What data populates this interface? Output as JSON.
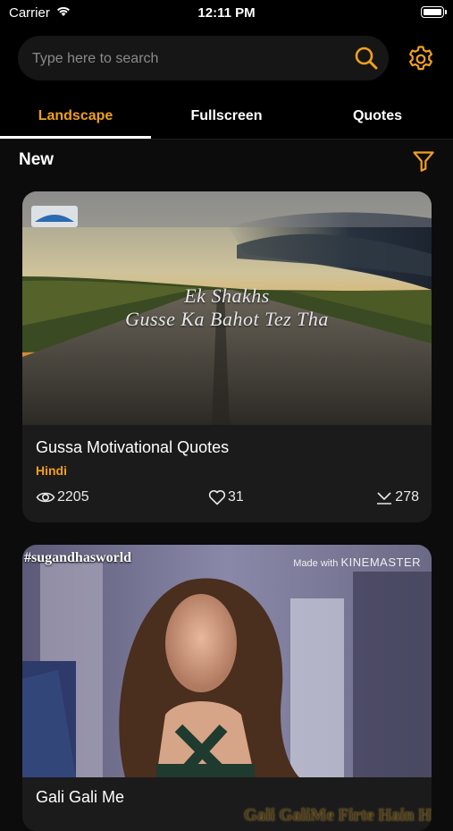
{
  "status_bar": {
    "carrier": "Carrier",
    "time": "12:11 PM"
  },
  "search": {
    "placeholder": "Type here to search"
  },
  "tabs": [
    {
      "label": "Landscape",
      "active": true
    },
    {
      "label": "Fullscreen",
      "active": false
    },
    {
      "label": "Quotes",
      "active": false
    }
  ],
  "section": {
    "title": "New"
  },
  "colors": {
    "accent": "#f0a020",
    "background": "#0c0c0c",
    "card": "#1b1b1b"
  },
  "cards": [
    {
      "thumbnail_text_line1": "Ek Shakhs",
      "thumbnail_text_line2": "Gusse Ka Bahot Tez Tha",
      "title": "Gussa Motivational Quotes",
      "language": "Hindi",
      "views": "2205",
      "likes": "31",
      "downloads": "278"
    },
    {
      "thumbnail_tag": "#sugandhasworld",
      "thumbnail_watermark_prefix": "Made with",
      "thumbnail_watermark_brand": "KINEMASTER",
      "thumbnail_lyric": "Gali GaliMe Firte Hain H",
      "title": "Gali Gali Me"
    }
  ],
  "icons": {
    "search": "search-icon",
    "settings": "gear-icon",
    "filter": "filter-icon",
    "views": "eye-icon",
    "likes": "heart-icon",
    "downloads": "download-icon"
  }
}
